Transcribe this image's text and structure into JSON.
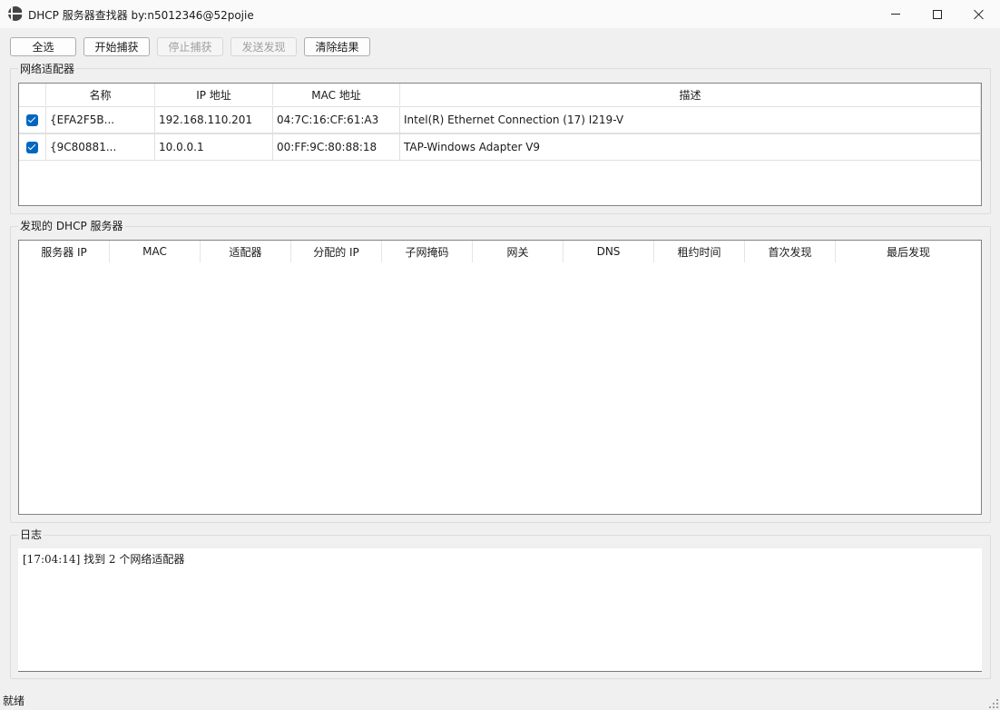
{
  "window": {
    "title": "DHCP 服务器查找器 by:n5012346@52pojie",
    "icon": "globe-icon"
  },
  "toolbar": {
    "select_all": "全选",
    "start_capture": "开始捕获",
    "stop_capture": "停止捕获",
    "send_discover": "发送发现",
    "clear_results": "清除结果"
  },
  "adapters": {
    "group_title": "网络适配器",
    "columns": [
      "名称",
      "IP 地址",
      "MAC 地址",
      "描述"
    ],
    "rows": [
      {
        "checked": true,
        "name": "{EFA2F5B...",
        "ip": "192.168.110.201",
        "mac": "04:7C:16:CF:61:A3",
        "desc": "Intel(R) Ethernet Connection (17) I219-V"
      },
      {
        "checked": true,
        "name": "{9C80881...",
        "ip": "10.0.0.1",
        "mac": "00:FF:9C:80:88:18",
        "desc": "TAP-Windows Adapter V9"
      }
    ]
  },
  "servers": {
    "group_title": "发现的 DHCP 服务器",
    "columns": [
      "服务器 IP",
      "MAC",
      "适配器",
      "分配的 IP",
      "子网掩码",
      "网关",
      "DNS",
      "租约时间",
      "首次发现",
      "最后发现"
    ]
  },
  "log": {
    "group_title": "日志",
    "lines": [
      "[17:04:14] 找到 2 个网络适配器"
    ]
  },
  "status": {
    "text": "就绪"
  },
  "colors": {
    "accent": "#0067c0",
    "background": "#f0f0f0"
  }
}
